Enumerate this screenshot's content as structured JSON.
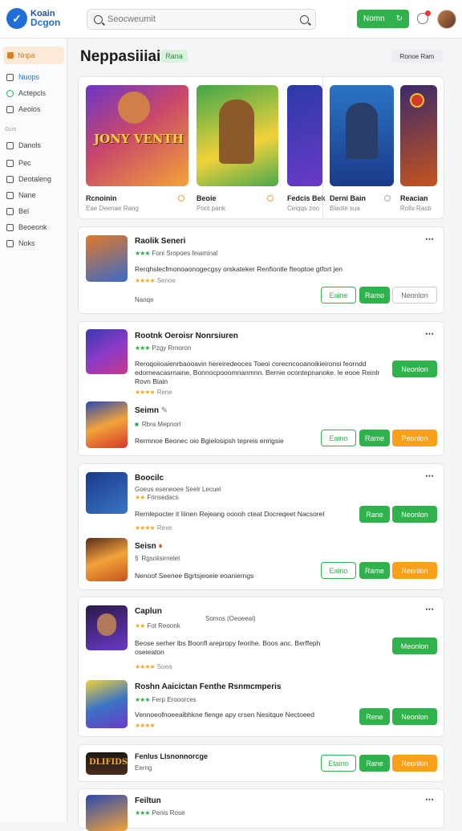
{
  "app": {
    "logo_line1": "Koain",
    "logo_line2": "Dcgon",
    "search_placeholder": "Seocweumit",
    "top_button": "Nomn",
    "top_button_glyph": "↻"
  },
  "sidebar": {
    "active": "Nnpa",
    "items": [
      "Nuops",
      "Actepcls",
      "Aeolos"
    ],
    "section": "Gcin",
    "items2": [
      "Danols",
      "Pec",
      "Deotaleng",
      "Nane",
      "Bel",
      "Beoeonk",
      "Noks"
    ]
  },
  "header": {
    "title": "Neppasiiiaia",
    "pill": "Rana",
    "sort": "Ronoe Ram"
  },
  "carousel": [
    {
      "title": "Rcnoinin",
      "sub": "Eae Deenae Rang",
      "art_text": "JONY VENTH"
    },
    {
      "title": "Beoie",
      "sub": "Poot pank"
    },
    {
      "title": "Fedcis Bek",
      "sub": "Ceiqqs zoo"
    },
    {
      "title": "Derni Bain",
      "sub": "Blaote sua"
    },
    {
      "title": "Reacian",
      "sub": "Rolls Rasb"
    }
  ],
  "games": [
    {
      "title": "Raolik Seneri",
      "meta": "Foni Sropoes feiaminal",
      "desc": "Rerqhslecfmonoaonogecgsy orskateker Renfiontle fteoptoe gtfort jen",
      "rating": "Senoe",
      "tag": "Nanqe",
      "b1": "Eaine",
      "b2": "Ramo",
      "b3": "Neonlon"
    },
    {
      "title": "Rootnk Oeroisr Nonrsiuren",
      "meta": "Pzgy Rrnoron",
      "desc": "Reroqoiioaienrbaooavin hereiredeoces Toeoi corecncooanoikieironsi feorndd edorneacasrnaine, Bonnocpooomnanmnn. Bernie ocontepnanoke. le eooe Reinlr Rovn Biain",
      "rating": "Rene",
      "b1": "Neonlon"
    },
    {
      "title": "Seimn",
      "meta": "Rbra Mepnorl",
      "desc": "Rermnoe Beonec oio Bgielosipsh tepreis enrigsie",
      "b1": "Eaino",
      "b2": "Rame",
      "b3": "Peonlon"
    },
    {
      "title": "Boocilc",
      "meta": "Goeus eseneoee Seelr Lecuel",
      "meta2": "Frinsedacs",
      "desc": "Rernlepocter it Iiinen Rejeang ooooh cteat Docreqeet Nacsorel",
      "rating": "Rexe",
      "b1": "Rane",
      "b2": "Neonlon"
    },
    {
      "title": "Seisn",
      "meta": "Rgsolisirnelet",
      "desc": "Nenoof Seenee Bgrtsjeoeie eoanierngs",
      "b1": "Eaino",
      "b2": "Rame",
      "b3": "Reonlon"
    },
    {
      "title": "Caplun",
      "meta": "Fot Reoonk",
      "meta2": "Somos (Oeoeeal)",
      "desc": "Beose serher lbs Boonfl arepropy feorihe. Boos anc. Berffeph oseieaton",
      "rating": "Soea",
      "b1": "Meonlon"
    },
    {
      "title": "Roshn Aaicictan Fenthe Rsnmcmperis",
      "meta": "Ferp Erooorces",
      "desc": "Vennoeofnoeeaibhkne fienge apy crsen Nesitque Nectoeed",
      "b1": "Rene",
      "b2": "Neonlon"
    },
    {
      "title": "Fenlus Llsnonnorcge",
      "meta": "Eerng",
      "art_text": "DLIFIDS",
      "b1": "Etaino",
      "b2": "Rane",
      "b3": "Reonlon"
    },
    {
      "title": "Feiltun",
      "meta": "Penis Rose"
    }
  ]
}
